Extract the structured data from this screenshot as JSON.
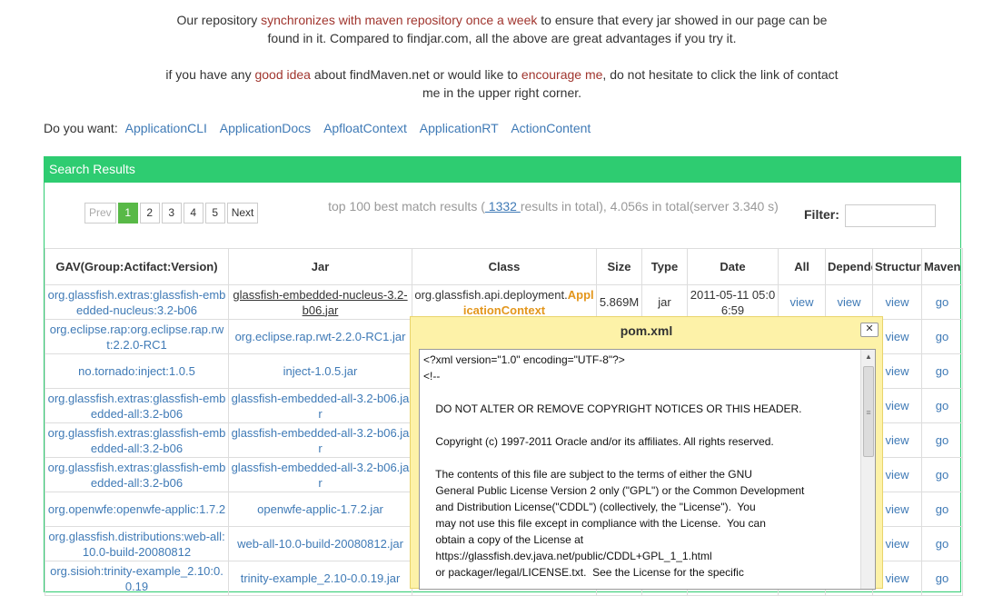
{
  "intro": {
    "p1_a": "Our repository ",
    "p1_link": "synchronizes with maven repository once a week",
    "p1_b": " to ensure that every jar showed in our page can be found in it. Compared to findjar.com, all the above are great advantages if you try it.",
    "p2_a": "if you have any ",
    "p2_link1": "good idea",
    "p2_b": " about findMaven.net or would like to ",
    "p2_link2": "encourage me",
    "p2_c": ", do not hesitate to click the link of contact me in the upper right corner."
  },
  "suggest": {
    "label": "Do you want:",
    "links": [
      "ApplicationCLI",
      "ApplicationDocs",
      "ApfloatContext",
      "ApplicationRT",
      "ActionContent"
    ]
  },
  "results": {
    "header": "Search Results",
    "pager": {
      "prev": "Prev",
      "pages": [
        "1",
        "2",
        "3",
        "4",
        "5"
      ],
      "next": "Next",
      "current": "1"
    },
    "summary_a": "top 100 best match results (",
    "summary_count": " 1332 ",
    "summary_b": "results in total), 4.056s in total(server 3.340 s)",
    "filter_label": "Filter:",
    "filter_value": "",
    "columns": [
      "GAV(Group:Actifact:Version)",
      "Jar",
      "Class",
      "Size",
      "Type",
      "Date",
      "All",
      "Dependency",
      "Structure",
      "Maven"
    ],
    "rows": [
      {
        "gav": "org.glassfish.extras:glassfish-embedded-nucleus:3.2-b06",
        "jar": "glassfish-embedded-nucleus-3.2-b06.jar",
        "class_prefix": "org.glassfish.api.deployment.",
        "class_hl": "ApplicationContext",
        "size": "5.869M",
        "type": "jar",
        "date": "2011-05-11 05:06:59",
        "all": "view",
        "dep": "view",
        "struct": "view",
        "maven": "go"
      },
      {
        "gav": "org.eclipse.rap:org.eclipse.rap.rwt:2.2.0-RC1",
        "jar": "org.eclipse.rap.rwt-2.2.0-RC1.jar",
        "struct": "view",
        "maven": "go"
      },
      {
        "gav": "no.tornado:inject:1.0.5",
        "jar": "inject-1.0.5.jar",
        "struct": "view",
        "maven": "go"
      },
      {
        "gav": "org.glassfish.extras:glassfish-embedded-all:3.2-b06",
        "jar": "glassfish-embedded-all-3.2-b06.jar",
        "struct": "view",
        "maven": "go"
      },
      {
        "gav": "org.glassfish.extras:glassfish-embedded-all:3.2-b06",
        "jar": "glassfish-embedded-all-3.2-b06.jar",
        "struct": "view",
        "maven": "go"
      },
      {
        "gav": "org.glassfish.extras:glassfish-embedded-all:3.2-b06",
        "jar": "glassfish-embedded-all-3.2-b06.jar",
        "struct": "view",
        "maven": "go"
      },
      {
        "gav": "org.openwfe:openwfe-applic:1.7.2",
        "jar": "openwfe-applic-1.7.2.jar",
        "struct": "view",
        "maven": "go"
      },
      {
        "gav": "org.glassfish.distributions:web-all:10.0-build-20080812",
        "jar": "web-all-10.0-build-20080812.jar",
        "struct": "view",
        "maven": "go"
      },
      {
        "gav": "org.sisioh:trinity-example_2.10:0.0.19",
        "jar": "trinity-example_2.10-0.0.19.jar",
        "struct": "view",
        "maven": "go"
      }
    ]
  },
  "dialog": {
    "title": "pom.xml",
    "close": "✕",
    "content": "<?xml version=\"1.0\" encoding=\"UTF-8\"?>\n<!--\n\n    DO NOT ALTER OR REMOVE COPYRIGHT NOTICES OR THIS HEADER.\n\n    Copyright (c) 1997-2011 Oracle and/or its affiliates. All rights reserved.\n\n    The contents of this file are subject to the terms of either the GNU\n    General Public License Version 2 only (\"GPL\") or the Common Development\n    and Distribution License(\"CDDL\") (collectively, the \"License\").  You\n    may not use this file except in compliance with the License.  You can\n    obtain a copy of the License at\n    https://glassfish.dev.java.net/public/CDDL+GPL_1_1.html\n    or packager/legal/LICENSE.txt.  See the License for the specific"
  }
}
